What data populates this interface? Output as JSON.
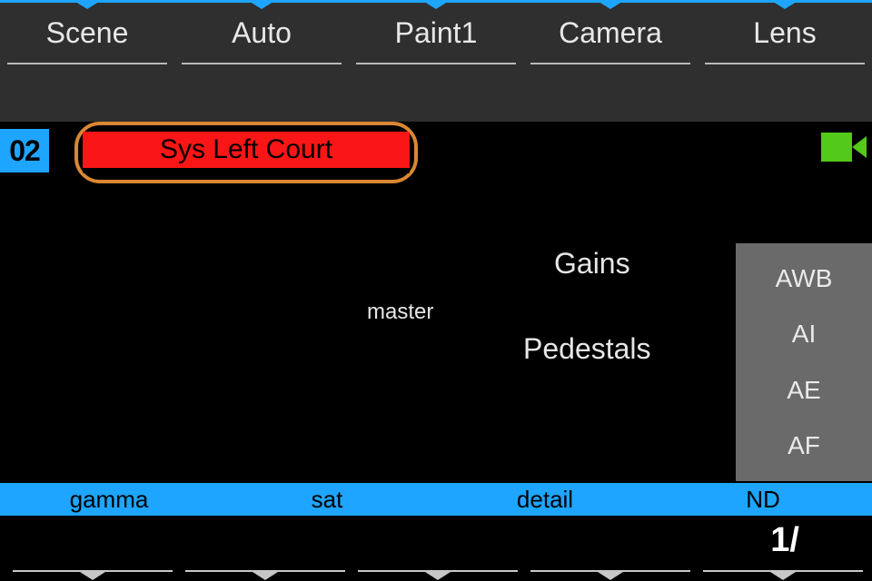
{
  "accent_blue": "#1ea5ff",
  "tabs": {
    "scene": "Scene",
    "auto": "Auto",
    "paint1": "Paint1",
    "camera": "Camera",
    "lens": "Lens"
  },
  "channel_number": "02",
  "scene_name": "Sys Left Court",
  "labels": {
    "master": "master",
    "gains": "Gains",
    "pedestals": "Pedestals"
  },
  "side_buttons": {
    "awb": "AWB",
    "ai": "AI",
    "ae": "AE",
    "af": "AF"
  },
  "param_strip": {
    "gamma": "gamma",
    "sat": "sat",
    "detail": "detail",
    "nd": "ND"
  },
  "nd_value": "1/"
}
